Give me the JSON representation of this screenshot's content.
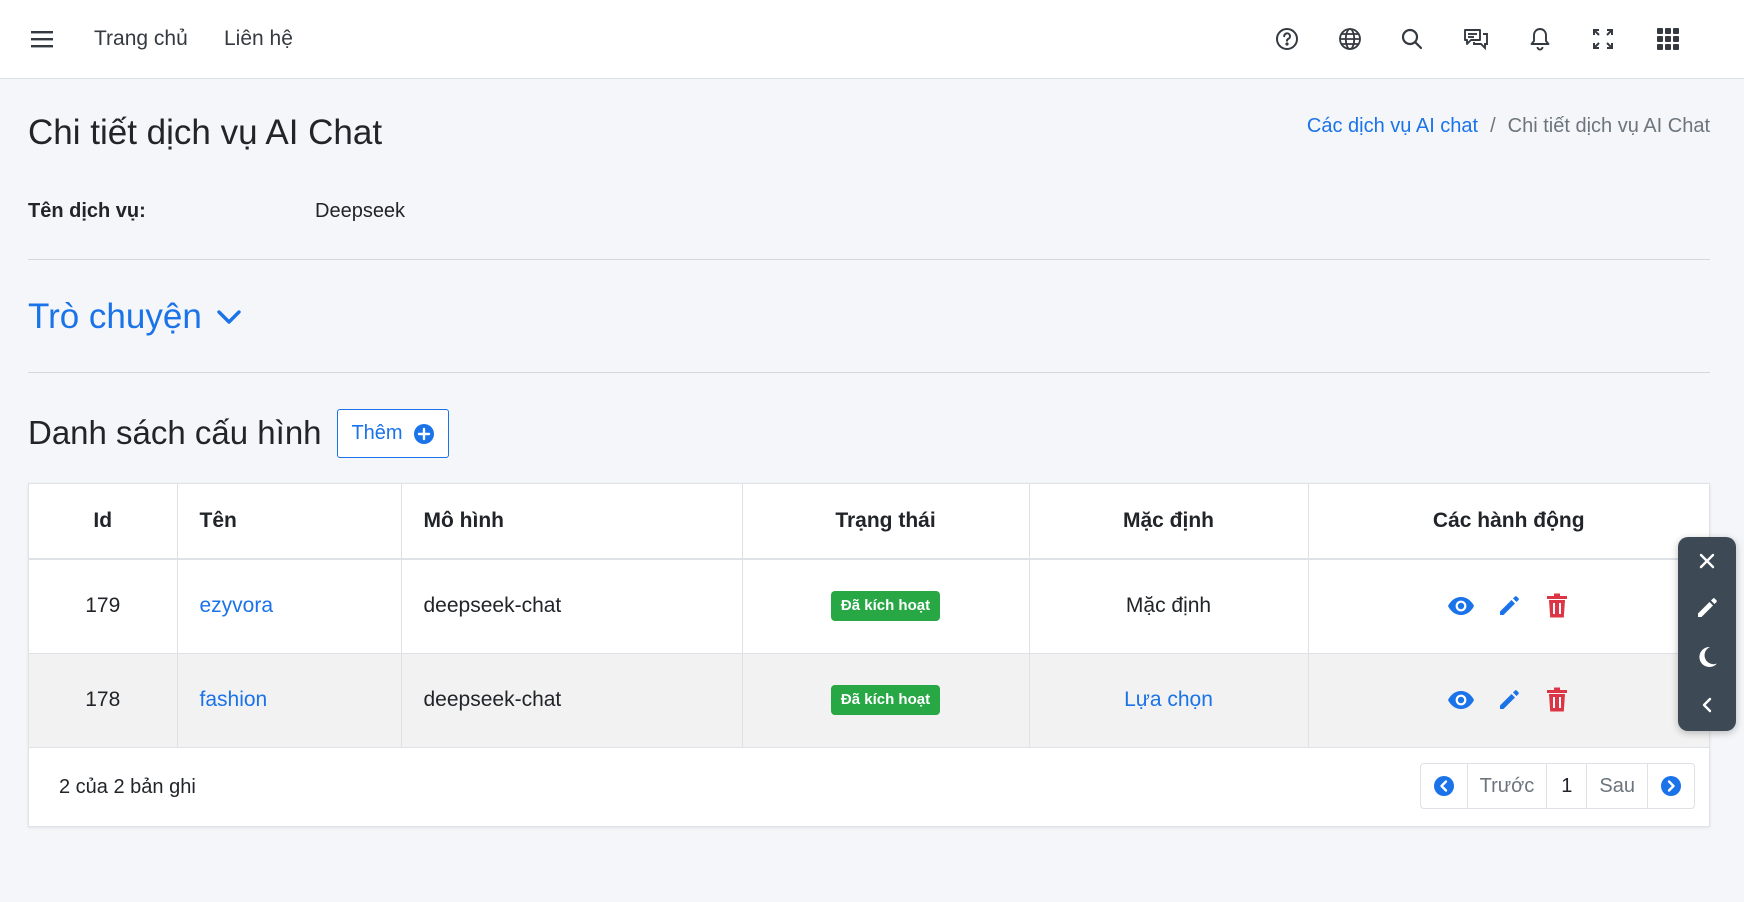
{
  "nav": {
    "links": [
      "Trang chủ",
      "Liên hệ"
    ],
    "icons": [
      "help-icon",
      "globe-icon",
      "search-icon",
      "chat-icon",
      "bell-icon",
      "fullscreen-icon",
      "apps-grid-icon"
    ]
  },
  "page": {
    "title": "Chi tiết dịch vụ AI Chat",
    "breadcrumb": {
      "parent": "Các dịch vụ AI chat",
      "separator": "/",
      "current": "Chi tiết dịch vụ AI Chat"
    }
  },
  "service": {
    "name_label": "Tên dịch vụ:",
    "name_value": "Deepseek"
  },
  "chat_section": {
    "label": "Trò chuyện"
  },
  "config_list": {
    "heading": "Danh sách cấu hình",
    "add_label": "Thêm",
    "columns": [
      "Id",
      "Tên",
      "Mô hình",
      "Trạng thái",
      "Mặc định",
      "Các hành động"
    ],
    "rows": [
      {
        "id": "179",
        "name": "ezyvora",
        "model": "deepseek-chat",
        "status": "Đã kích hoạt",
        "default": "Mặc định"
      },
      {
        "id": "178",
        "name": "fashion",
        "model": "deepseek-chat",
        "status": "Đã kích hoạt",
        "default": "Lựa chọn"
      }
    ],
    "records_text": "2 của 2 bản ghi",
    "pager": {
      "prev": "Trước",
      "page": "1",
      "next": "Sau"
    }
  },
  "colors": {
    "primary": "#1a73e8",
    "success": "#28a745",
    "danger": "#dc3545",
    "panel": "#3d4a56"
  }
}
